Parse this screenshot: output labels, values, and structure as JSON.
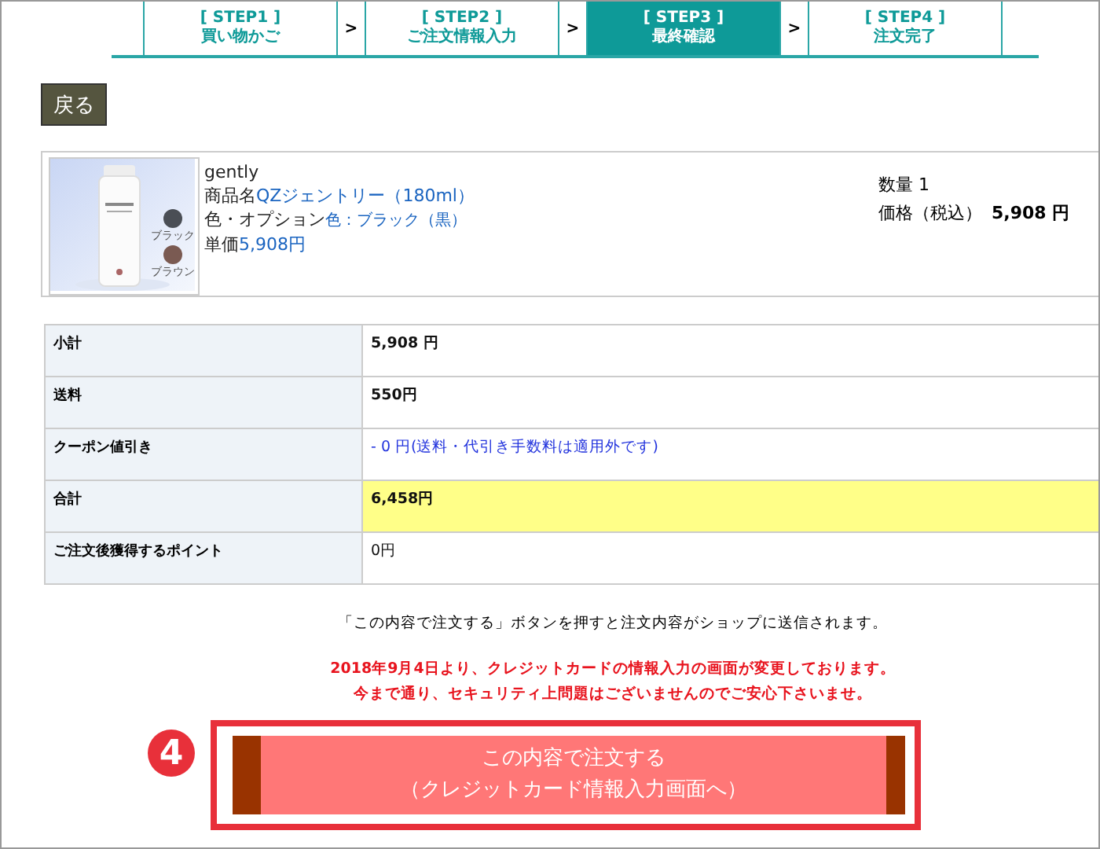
{
  "steps": [
    {
      "label": "[ STEP1 ]",
      "title": "買い物かご",
      "selected": false
    },
    {
      "label": "[ STEP2 ]",
      "title": "ご注文情報入力",
      "selected": false
    },
    {
      "label": "[ STEP3 ]",
      "title": "最終確認",
      "selected": true
    },
    {
      "label": "[ STEP4 ]",
      "title": "注文完了",
      "selected": false
    }
  ],
  "step_separators": [
    ">",
    ">",
    ">"
  ],
  "back_button": "戻る",
  "product": {
    "brand": "gently",
    "name_label": "商品名",
    "name": "QZジェントリー（180ml）",
    "option_label": "色・オプション",
    "option": "色：ブラック（黒）",
    "unit_price_label": "単価",
    "unit_price": "5,908円",
    "quantity": "数量 1",
    "price_label": "価格（税込）",
    "price": "5,908 円",
    "swatches": [
      {
        "label": "ブラック",
        "color": "#4a4e55"
      },
      {
        "label": "ブラウン",
        "color": "#7a5a52"
      }
    ]
  },
  "summary": [
    {
      "label": "小計",
      "value": "5,908 円",
      "kind": "amount"
    },
    {
      "label": "送料",
      "value": "550円",
      "kind": "amount"
    },
    {
      "label": "クーポン値引き",
      "value": "- 0 円(送料・代引き手数料は適用外です)",
      "kind": "coupon"
    },
    {
      "label": "合計",
      "value": "6,458円",
      "kind": "total"
    },
    {
      "label": "ご注文後獲得するポイント",
      "value": "0円",
      "kind": "points"
    }
  ],
  "notice": "「この内容で注文する」ボタンを押すと注文内容がショップに送信されます。",
  "warning": [
    "2018年9月4日より、クレジットカードの情報入力の画面が変更しております。",
    "今まで通り、セキュリティ上問題はございませんのでご安心下さいませ。"
  ],
  "callout_number": "4",
  "order_button": [
    "この内容で注文する",
    "（クレジットカード情報入力画面へ）"
  ]
}
